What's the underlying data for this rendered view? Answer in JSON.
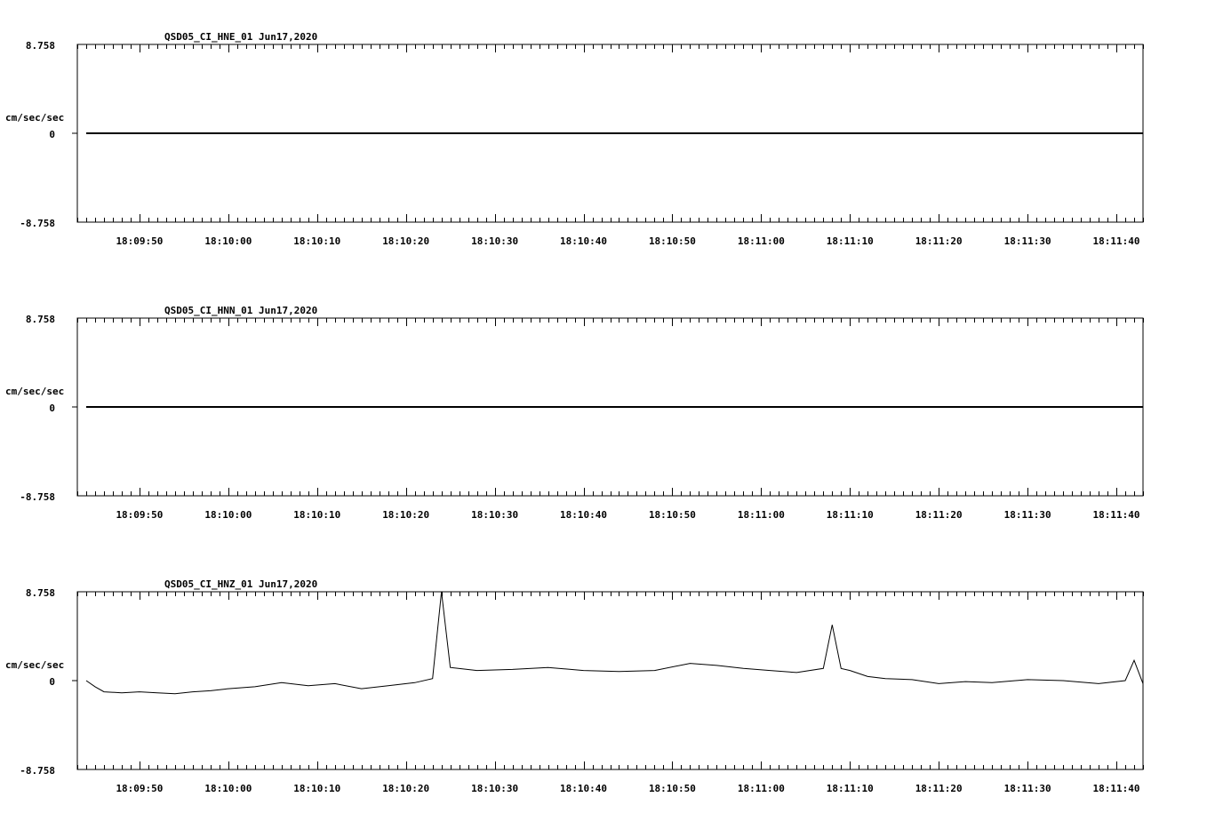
{
  "chart_data": [
    {
      "type": "line",
      "title": "QSD05_CI_HNE_01  Jun17,2020",
      "ylabel": "cm/sec/sec",
      "ylim": [
        -8.758,
        8.758
      ],
      "y_tick_labels": [
        "8.758",
        "0",
        "-8.758"
      ],
      "x_tick_labels": [
        "18:09:50",
        "18:10:00",
        "18:10:10",
        "18:10:20",
        "18:10:30",
        "18:10:40",
        "18:10:50",
        "18:11:00",
        "18:11:10",
        "18:11:20",
        "18:11:30",
        "18:11:40"
      ],
      "xlim": [
        "18:09:43",
        "18:11:43"
      ],
      "series": [
        {
          "x": [
            "18:09:44",
            "18:11:43"
          ],
          "values": [
            0,
            0
          ]
        }
      ]
    },
    {
      "type": "line",
      "title": "QSD05_CI_HNN_01  Jun17,2020",
      "ylabel": "cm/sec/sec",
      "ylim": [
        -8.758,
        8.758
      ],
      "y_tick_labels": [
        "8.758",
        "0",
        "-8.758"
      ],
      "x_tick_labels": [
        "18:09:50",
        "18:10:00",
        "18:10:10",
        "18:10:20",
        "18:10:30",
        "18:10:40",
        "18:10:50",
        "18:11:00",
        "18:11:10",
        "18:11:20",
        "18:11:30",
        "18:11:40"
      ],
      "xlim": [
        "18:09:43",
        "18:11:43"
      ],
      "series": [
        {
          "x": [
            "18:09:44",
            "18:11:43"
          ],
          "values": [
            0,
            0
          ]
        }
      ]
    },
    {
      "type": "line",
      "title": "QSD05_CI_HNZ_01  Jun17,2020",
      "ylabel": "cm/sec/sec",
      "ylim": [
        -8.758,
        8.758
      ],
      "y_tick_labels": [
        "8.758",
        "0",
        "-8.758"
      ],
      "x_tick_labels": [
        "18:09:50",
        "18:10:00",
        "18:10:10",
        "18:10:20",
        "18:10:30",
        "18:10:40",
        "18:10:50",
        "18:11:00",
        "18:11:10",
        "18:11:20",
        "18:11:30",
        "18:11:40"
      ],
      "xlim": [
        "18:09:43",
        "18:11:43"
      ],
      "series": [
        {
          "x": [
            "18:09:44",
            "18:09:45",
            "18:09:46",
            "18:09:48",
            "18:09:50",
            "18:09:52",
            "18:09:54",
            "18:09:56",
            "18:09:58",
            "18:10:00",
            "18:10:03",
            "18:10:06",
            "18:10:09",
            "18:10:12",
            "18:10:15",
            "18:10:18",
            "18:10:21",
            "18:10:23",
            "18:10:24",
            "18:10:25",
            "18:10:28",
            "18:10:32",
            "18:10:36",
            "18:10:40",
            "18:10:44",
            "18:10:48",
            "18:10:52",
            "18:10:55",
            "18:10:58",
            "18:11:01",
            "18:11:04",
            "18:11:07",
            "18:11:08",
            "18:11:09",
            "18:11:10",
            "18:11:12",
            "18:11:14",
            "18:11:17",
            "18:11:20",
            "18:11:23",
            "18:11:26",
            "18:11:30",
            "18:11:34",
            "18:11:38",
            "18:11:41",
            "18:11:42",
            "18:11:43"
          ],
          "values": [
            0.0,
            -0.6,
            -1.1,
            -1.2,
            -1.1,
            -1.2,
            -1.3,
            -1.1,
            -1.0,
            -0.8,
            -0.6,
            -0.2,
            -0.5,
            -0.3,
            -0.8,
            -0.5,
            -0.2,
            0.2,
            8.758,
            1.3,
            1.0,
            1.1,
            1.3,
            1.0,
            0.9,
            1.0,
            1.7,
            1.5,
            1.2,
            1.0,
            0.8,
            1.2,
            5.5,
            1.2,
            1.0,
            0.4,
            0.2,
            0.1,
            -0.3,
            -0.1,
            -0.2,
            0.1,
            0.0,
            -0.3,
            0.0,
            2.0,
            -0.3
          ]
        }
      ]
    }
  ]
}
